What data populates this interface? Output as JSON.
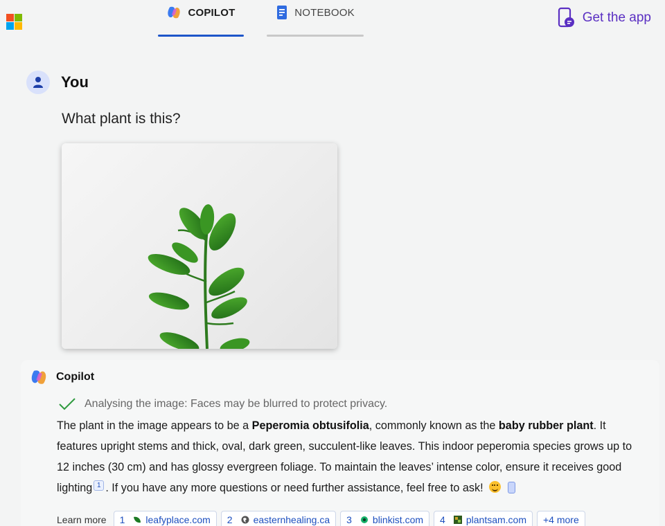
{
  "header": {
    "tabs": [
      {
        "label": "COPILOT",
        "icon": "copilot-icon",
        "active": true
      },
      {
        "label": "NOTEBOOK",
        "icon": "notebook-icon",
        "active": false
      }
    ],
    "get_app_label": "Get the app",
    "get_app_icon": "phone-chat-icon",
    "logo_colors": [
      "#f25022",
      "#7fba00",
      "#00a4ef",
      "#ffb900"
    ]
  },
  "user_message": {
    "author": "You",
    "text": "What plant is this?",
    "attachment_icon": "plant-photo"
  },
  "response": {
    "author": "Copilot",
    "status": "Analysing the image: Faces may be blurred to protect privacy.",
    "paragraph": {
      "p1": "The plant in the image appears to be a ",
      "b1": "Peperomia obtusifolia",
      "p2": ", commonly known as the ",
      "b2": "baby rubber plant",
      "p3": ". It features upright stems and thick, oval, dark green, succulent-like leaves. This indoor peperomia species grows up to 12 inches (30 cm) and has glossy evergreen foliage. To maintain the leaves’ intense color, ensure it receives good lighting",
      "cite": "1",
      "p4": ". If you have any more questions or need further assistance, feel free to ask!"
    },
    "learn_more_label": "Learn more",
    "sources": [
      {
        "num": "1",
        "label": "leafyplace.com",
        "icon": "leaf-icon"
      },
      {
        "num": "2",
        "label": "easternhealing.ca",
        "icon": "globe-icon"
      },
      {
        "num": "3",
        "label": "blinkist.com",
        "icon": "blinkist-icon"
      },
      {
        "num": "4",
        "label": "plantsam.com",
        "icon": "plantsam-icon"
      }
    ],
    "more_label": "+4 more"
  },
  "colors": {
    "accent": "#1d55c9",
    "get_app": "#5a2fc2",
    "status_check": "#2e9a3e",
    "link": "#1d4fbf"
  }
}
